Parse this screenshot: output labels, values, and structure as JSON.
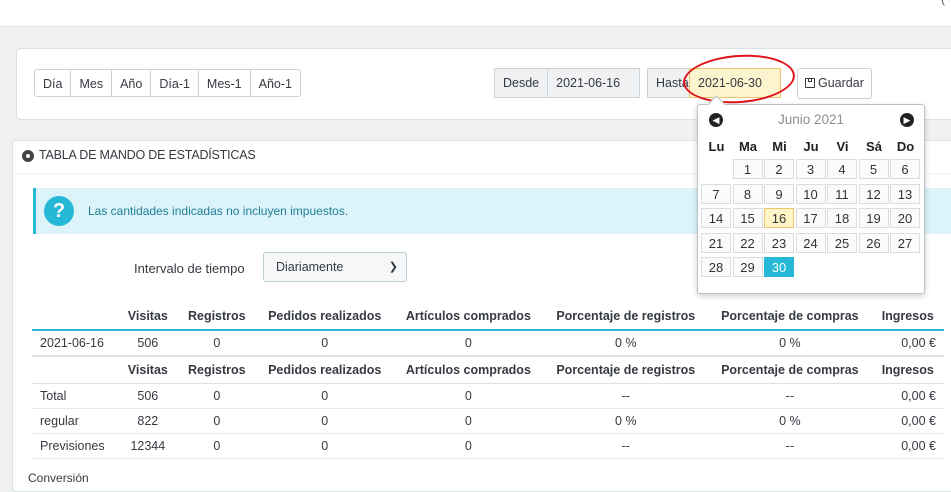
{
  "toolbar": {
    "top_glyph": "(",
    "presets": [
      "Día",
      "Mes",
      "Año",
      "Día-1",
      "Mes-1",
      "Año-1"
    ],
    "desde_label": "Desde",
    "desde_value": "2021-06-16",
    "hasta_label": "Hasta",
    "hasta_value": "2021-06-30",
    "save_label": "Guardar"
  },
  "panel": {
    "title": "TABLA DE MANDO DE ESTADÍSTICAS",
    "alert": "Las cantidades indicadas no incluyen impuestos.",
    "interval_label": "Intervalo de tiempo",
    "interval_value": "Diariamente"
  },
  "table": {
    "headers": [
      "",
      "Visitas",
      "Registros",
      "Pedidos realizados",
      "Artículos comprados",
      "Porcentaje de registros",
      "Porcentaje de compras",
      "Ingresos"
    ],
    "rows": [
      [
        "2021-06-16",
        "506",
        "0",
        "0",
        "0",
        "0 %",
        "0 %",
        "0,00 €"
      ]
    ],
    "summary_rows": [
      [
        "Total",
        "506",
        "0",
        "0",
        "0",
        "--",
        "--",
        "0,00 €"
      ],
      [
        "regular",
        "822",
        "0",
        "0",
        "0",
        "0 %",
        "0 %",
        "0,00 €"
      ],
      [
        "Previsiones",
        "12344",
        "0",
        "0",
        "0",
        "--",
        "--",
        "0,00 €"
      ]
    ],
    "footer_label": "Conversión"
  },
  "datepicker": {
    "month_title": "Junio 2021",
    "weekdays": [
      "Lu",
      "Ma",
      "Mi",
      "Ju",
      "Vi",
      "Sá",
      "Do"
    ],
    "first_weekday_index": 1,
    "days_in_month": 30,
    "today": 16,
    "selected": 30
  }
}
